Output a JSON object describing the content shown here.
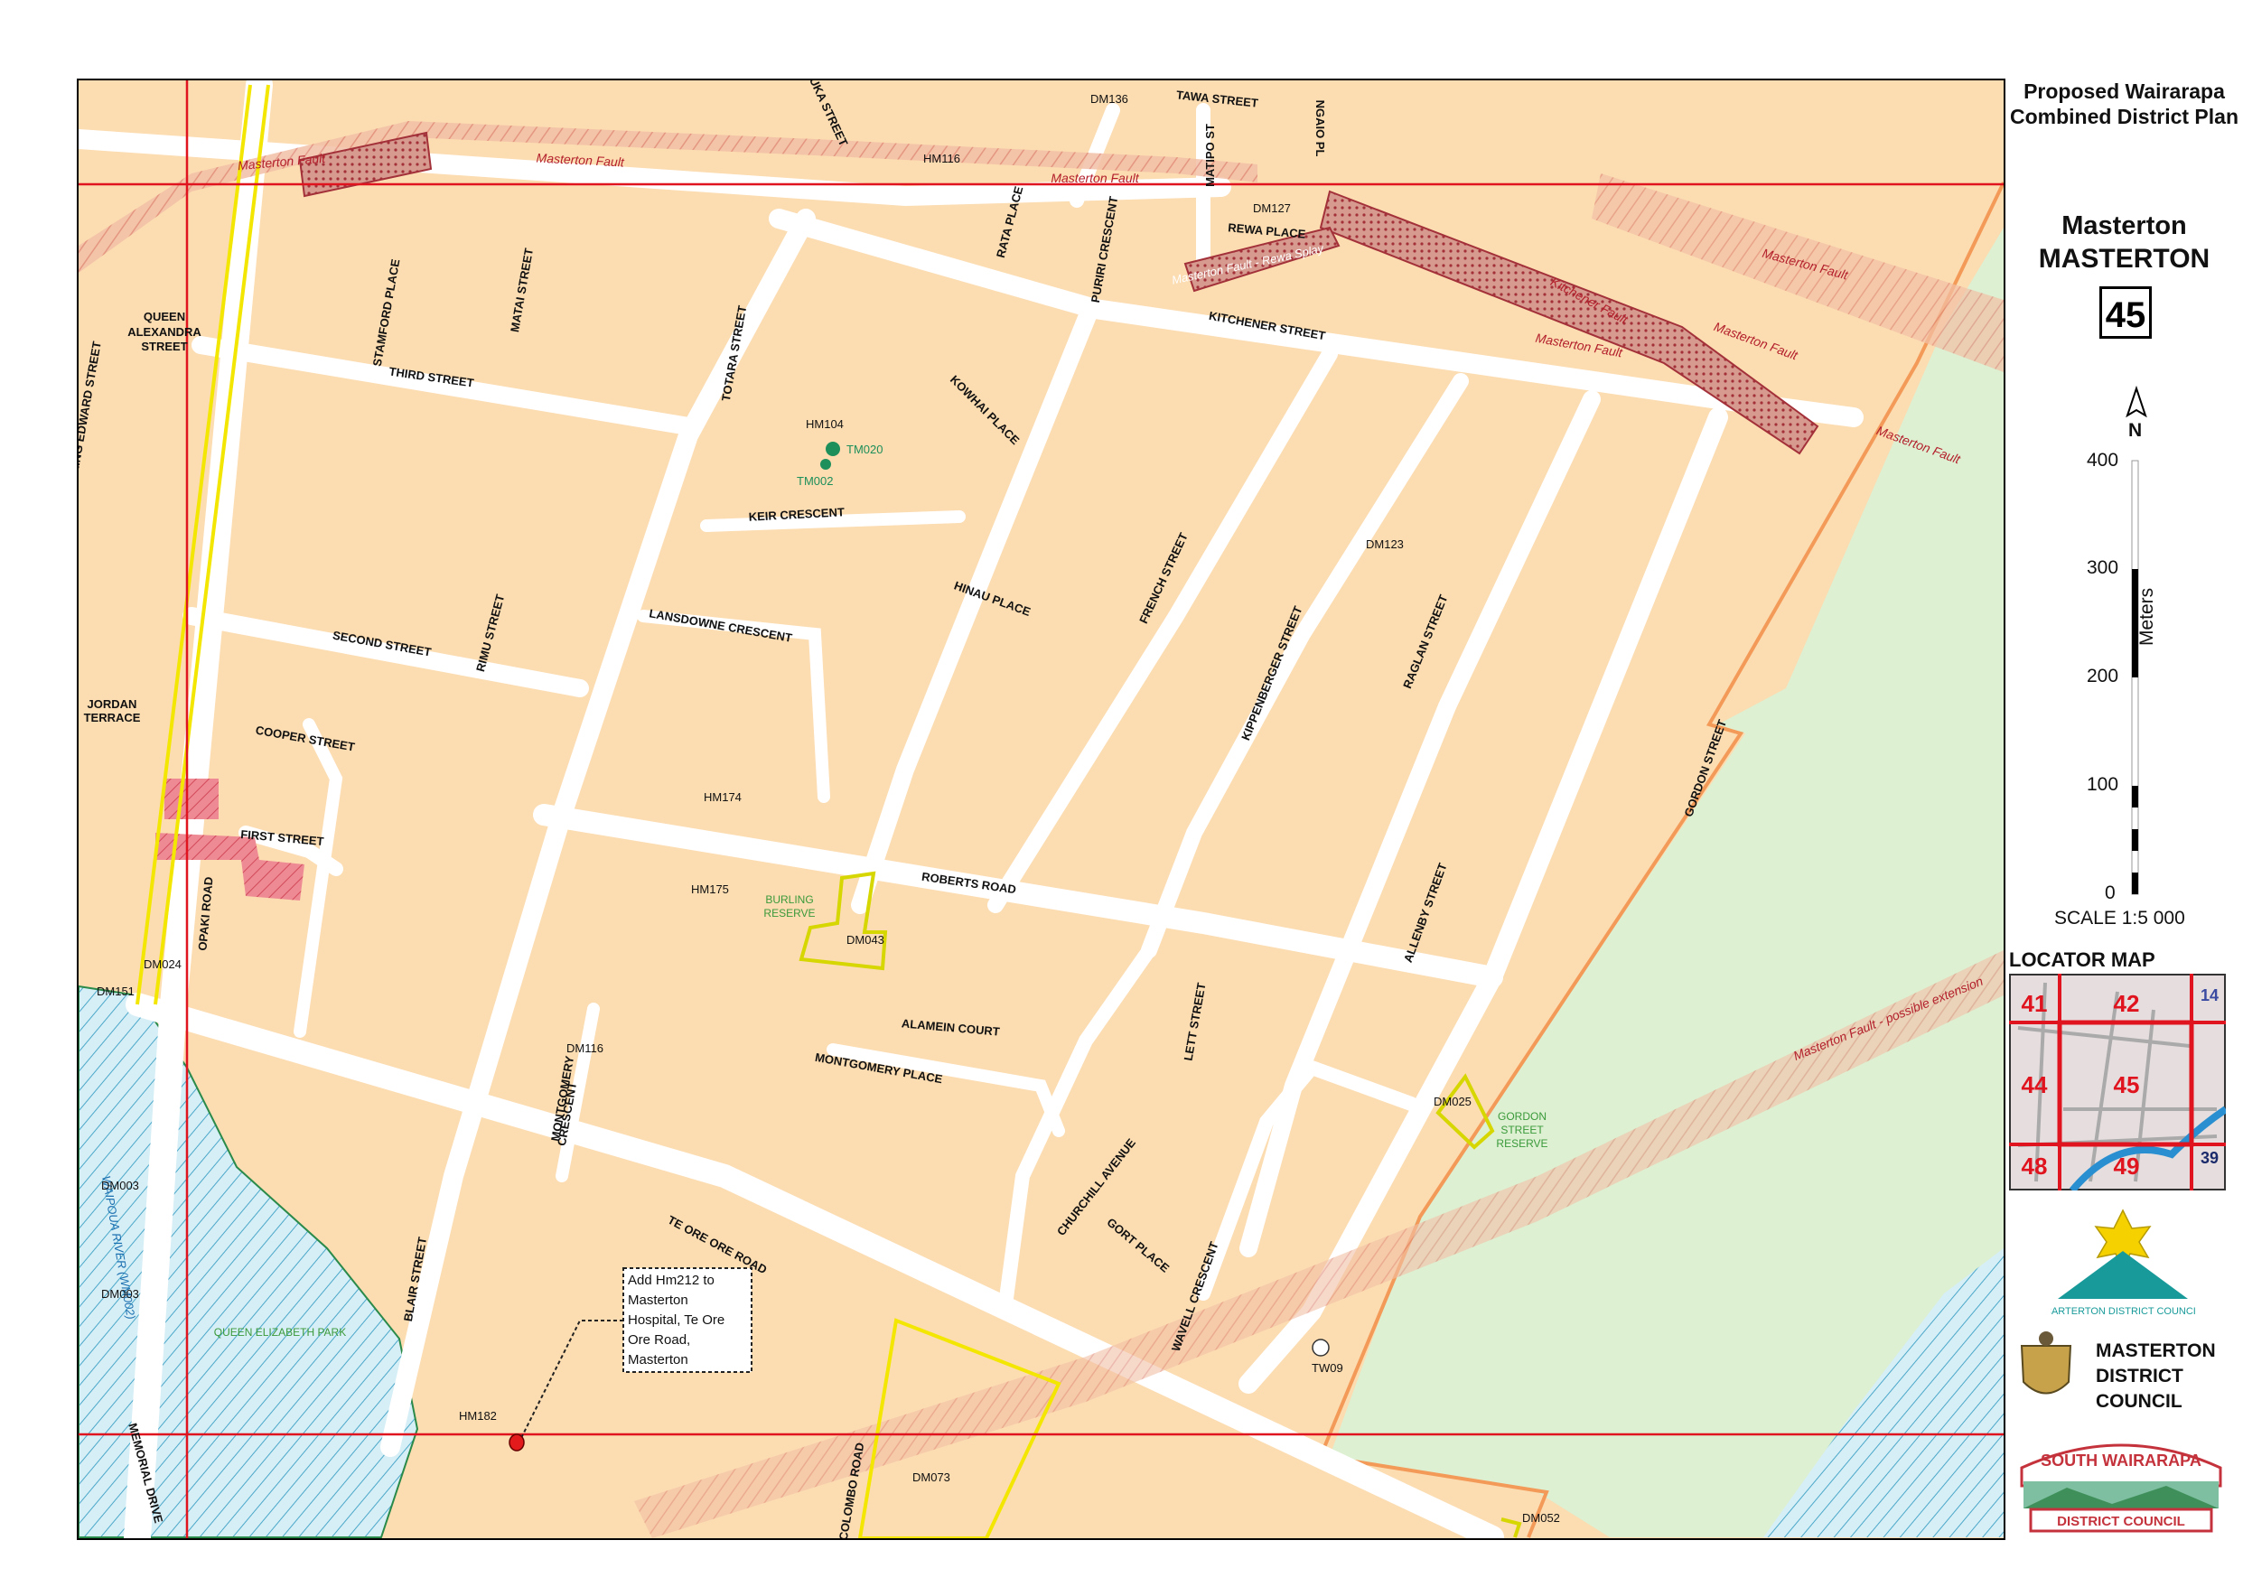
{
  "header": {
    "line1": "Proposed Wairarapa",
    "line2": "Combined District Plan",
    "place_small": "Masterton",
    "place_big": "MASTERTON",
    "sheet_number": "45"
  },
  "scale": {
    "north": "N",
    "ticks": [
      "400",
      "300",
      "200",
      "100",
      "0"
    ],
    "unit": "Meters",
    "label": "SCALE 1:5 000"
  },
  "locator": {
    "title": "LOCATOR MAP",
    "sheets": [
      "41",
      "42",
      "14",
      "44",
      "45",
      "48",
      "49",
      "39"
    ]
  },
  "logos": {
    "carterton": "CARTERTON DISTRICT COUNCIL",
    "masterton": [
      "MASTERTON",
      "DISTRICT",
      "COUNCIL"
    ],
    "south_wairarapa_top": "SOUTH WAIRARAPA",
    "south_wairarapa_bottom": "DISTRICT COUNCIL"
  },
  "annotation": {
    "lines": [
      "Add Hm212 to",
      "Masterton",
      "Hospital, Te Ore",
      "Ore Road,",
      "Masterton"
    ]
  },
  "streets": [
    "TAWA STREET",
    "MANUKA STREET",
    "NGAIO PL",
    "MATIPO ST",
    "REWA PLACE",
    "RATA PLACE",
    "PURIRI CRESCENT",
    "STAMFORD PLACE",
    "MATAI STREET",
    "QUEEN",
    "ALEXANDRA",
    "STREET",
    "KING EDWARD STREET",
    "THIRD STREET",
    "TOTARA STREET",
    "KOWHAI PLACE",
    "KITCHENER STREET",
    "KEIR CRESCENT",
    "HINAU PLACE",
    "FRENCH STREET",
    "KIPPENBERGER STREET",
    "RAGLAN STREET",
    "LANSDOWNE CRESCENT",
    "RIMU STREET",
    "SECOND STREET",
    "OPAKI ROAD",
    "JORDAN",
    "TERRACE",
    "COOPER STREET",
    "FIRST STREET",
    "ROBERTS ROAD",
    "GORDON STREET",
    "ALLENBY STREET",
    "ALAMEIN COURT",
    "MONTGOMERY PLACE",
    "LETT STREET",
    "MONTGOMERY",
    "CRESCENT",
    "CHURCHILL AVENUE",
    "TE ORE ORE ROAD",
    "BLAIR STREET",
    "GORT PLACE",
    "WAVELL CRESCENT",
    "COLOMBO ROAD",
    "MEMORIAL DRIVE"
  ],
  "features": {
    "faults": [
      "Masterton Fault",
      "Masterton Fault - Rewa Splay",
      "Kitchener Fault",
      "Masterton Fault - possible extension"
    ],
    "reserves": [
      "BURLING",
      "RESERVE",
      "GORDON",
      "STREET",
      "RESERVE",
      "QUEEN ELIZABETH PARK"
    ],
    "river": "WAIPOUA RIVER (WM002)"
  },
  "codes": [
    "DM136",
    "HM116",
    "DM127",
    "HM104",
    "TM020",
    "TM002",
    "DM123",
    "HM174",
    "HM175",
    "DM043",
    "DM024",
    "DM151",
    "DM116",
    "DM025",
    "DM003",
    "DM003",
    "TW09",
    "HM182",
    "DM073",
    "DM052"
  ],
  "colors": {
    "background": "#fcdcb1",
    "road": "#ffffff",
    "grid_line": "#e0141e",
    "fault": "#c4323c",
    "reserve": "#ddf0d2",
    "boundary": "#f39a58",
    "highlight": "#f3e600"
  }
}
